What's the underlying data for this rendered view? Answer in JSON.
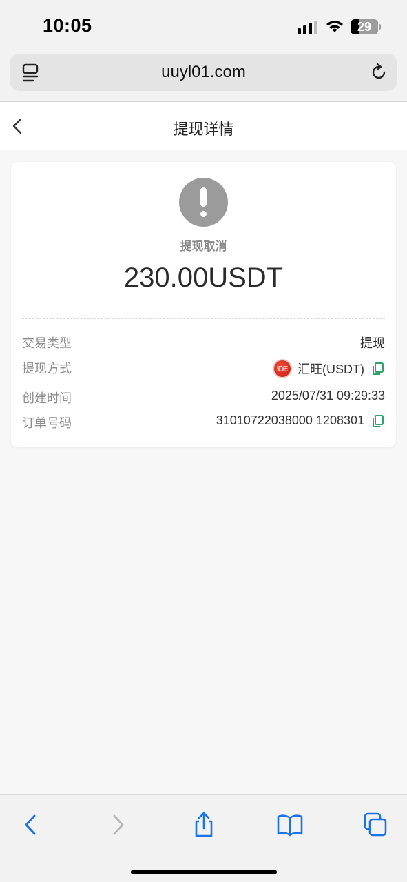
{
  "status_bar": {
    "time": "10:05",
    "battery": "29",
    "battery_level": 0.29
  },
  "browser": {
    "url": "uuyl01.com"
  },
  "header": {
    "title": "提现详情"
  },
  "card": {
    "status_label": "提现取消",
    "amount": "230.00USDT",
    "rows": [
      {
        "label": "交易类型",
        "value": "提现"
      },
      {
        "label": "提现方式",
        "value": "汇旺(USDT)",
        "logo_text": "汇旺"
      },
      {
        "label": "创建时间",
        "value": "2025/07/31 09:29:33"
      },
      {
        "label": "订单号码",
        "value": "31010722038000 1208301"
      }
    ]
  },
  "colors": {
    "accent_green": "#2fa36b",
    "status_gray": "#9b9b9b",
    "ios_blue": "#1a73e8"
  }
}
